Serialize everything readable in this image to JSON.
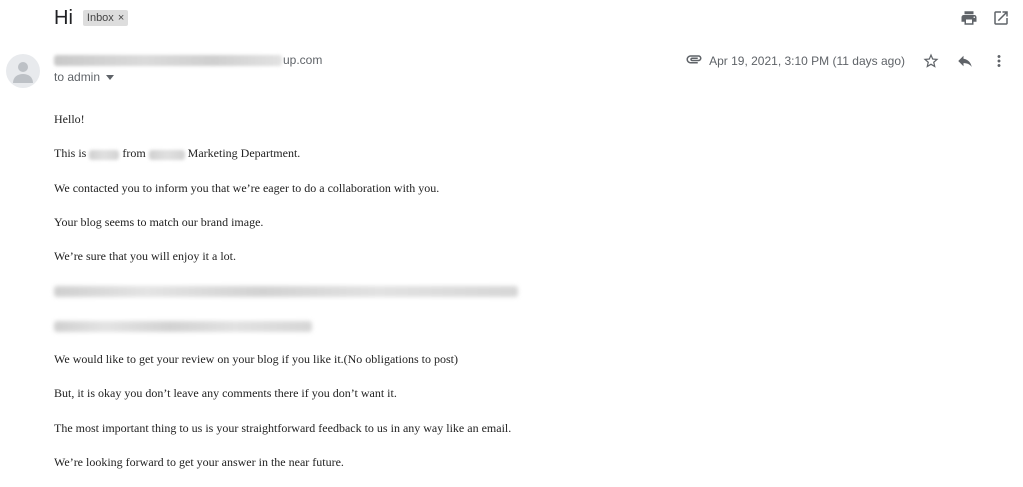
{
  "email": {
    "subject": "Hi",
    "label": "Inbox",
    "label_close": "×",
    "sender_domain_suffix": "up.com",
    "recipient": "to admin",
    "date": "Apr 19, 2021, 3:10 PM (11 days ago)"
  },
  "icons": {
    "print": "print-icon",
    "open_new_window": "open-in-new-window-icon",
    "attachment": "paperclip-icon",
    "star": "star-icon",
    "reply": "reply-icon",
    "more": "more-vertical-icon",
    "avatar": "person-icon",
    "recipient_details": "chevron-down-icon"
  },
  "body": {
    "p1": "Hello!",
    "p2_prefix": "This is",
    "p2_mid": "from",
    "p2_suffix": "Marketing Department.",
    "p3": "We contacted you to inform you that we’re eager to do a collaboration with you.",
    "p4": "Your blog seems to match our brand image.",
    "p5": "We’re sure that you will enjoy it a lot.",
    "p8": "We would like to get your review on your blog if you like it.(No obligations to post)",
    "p9": "But, it is okay you don’t leave any comments there if you don’t want it.",
    "p10": "The most important thing to us is your straightforward feedback to us in any way like an email.",
    "p11": "We’re looking forward to get your answer in the near future."
  },
  "colors": {
    "text_primary": "#202124",
    "text_secondary": "#5f6368",
    "chip_background": "#dddddd"
  }
}
